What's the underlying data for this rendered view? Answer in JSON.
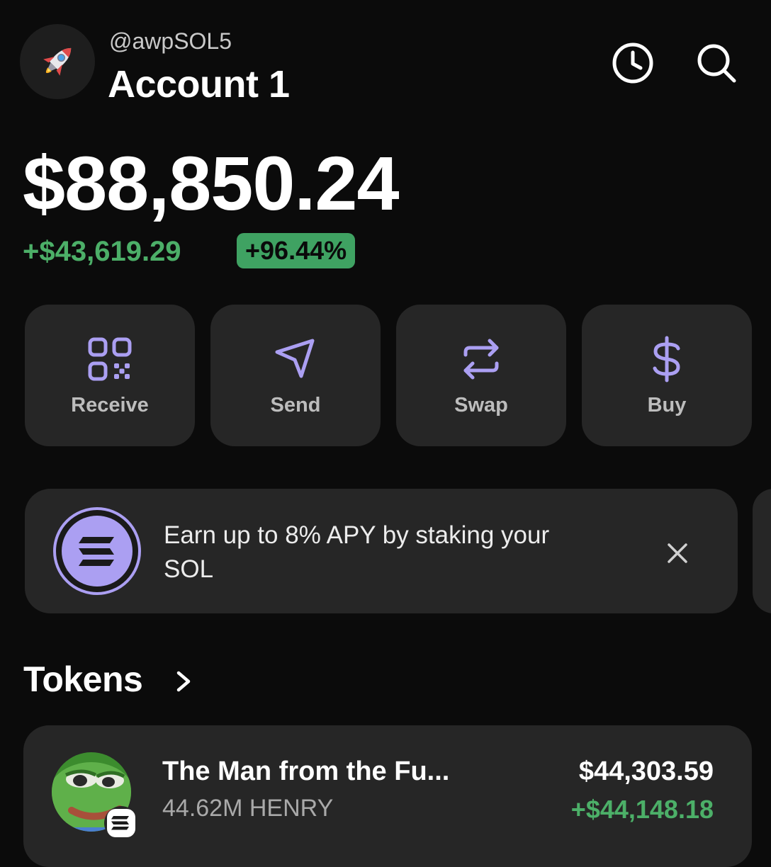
{
  "header": {
    "avatar_icon": "rocket-icon",
    "handle": "@awpSOL5",
    "account_name": "Account 1",
    "icons": [
      "history-icon",
      "search-icon"
    ]
  },
  "balance": {
    "total": "$88,850.24",
    "change_abs": "+$43,619.29",
    "change_pct": "+96.44%"
  },
  "actions": [
    {
      "label": "Receive",
      "icon": "qr-code-icon"
    },
    {
      "label": "Send",
      "icon": "send-icon"
    },
    {
      "label": "Swap",
      "icon": "swap-icon"
    },
    {
      "label": "Buy",
      "icon": "dollar-icon"
    }
  ],
  "promo": {
    "text": "Earn up to 8% APY by staking your SOL",
    "icon": "solana-icon",
    "close_icon": "close-icon"
  },
  "tokens": {
    "title": "Tokens",
    "items": [
      {
        "name": "The Man from the Fu...",
        "amount": "44.62M HENRY",
        "value": "$44,303.59",
        "change": "+$44,148.18"
      }
    ]
  },
  "colors": {
    "background": "#0b0b0b",
    "card": "#262626",
    "accent_purple": "#ab9ff2",
    "positive_green": "#4caf68",
    "badge_green": "#3fa262"
  }
}
